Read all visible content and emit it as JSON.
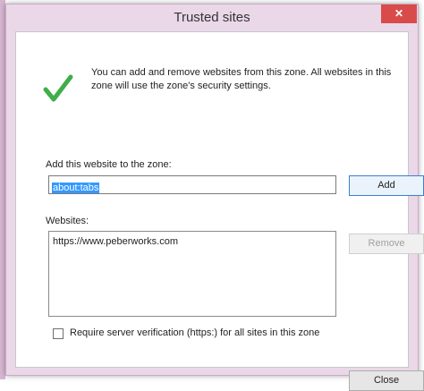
{
  "window": {
    "title": "Trusted sites",
    "close_symbol": "✕"
  },
  "info": {
    "text": "You can add and remove websites from this zone. All websites in this zone will use the zone's security settings.",
    "icon": "checkmark-icon"
  },
  "add_section": {
    "label": "Add this website to the zone:",
    "input_value": "about:tabs",
    "add_button": "Add"
  },
  "websites": {
    "label": "Websites:",
    "items": [
      "https://www.peberworks.com"
    ],
    "remove_button": "Remove"
  },
  "verification": {
    "label": "Require server verification (https:) for all sites in this zone",
    "checked": false
  },
  "footer": {
    "close_button": "Close"
  },
  "colors": {
    "titlebar_bg": "#ead8e8",
    "close_button_bg": "#d94b4b",
    "selection_bg": "#3399ff",
    "check_green": "#3fae49"
  }
}
